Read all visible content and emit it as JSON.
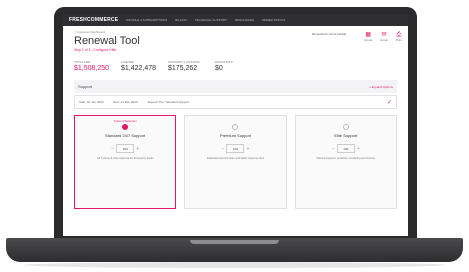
{
  "app": {
    "brand": "FRESHCOMMERCE",
    "nav": [
      "PROFILE & SUBSCRIPTIONS",
      "BILLING",
      "TECHNICAL SUPPORT",
      "RESOURCES",
      "ORDER STATUS"
    ]
  },
  "page": {
    "breadcrumb": "< Customer Dashboard",
    "title": "Renewal Tool",
    "subtitle": "Step 1 of 3 - Configure Offer",
    "account_text": "Renewal for Acme Global",
    "tools": [
      {
        "icon": "▦",
        "label": "Quote"
      },
      {
        "icon": "✉",
        "label": "Email"
      },
      {
        "icon": "⎙",
        "label": "Print"
      }
    ]
  },
  "stats": [
    {
      "label": "TOTAL ARR",
      "value": "$1,508,250",
      "accent": true
    },
    {
      "label": "LICENSE",
      "value": "$1,422,478",
      "accent": false
    },
    {
      "label": "SUPPORT & HOSTING",
      "value": "$175,262",
      "accent": false
    },
    {
      "label": "DISCOUNTS",
      "value": "$0",
      "accent": false
    }
  ],
  "section": {
    "label": "Support",
    "link": "+ Expand Options"
  },
  "filters": [
    "Start: 01 Jan 2023",
    "End: 31 Dec 2023",
    "Support Tier: Standard Support"
  ],
  "cards": [
    {
      "tag": "Current Selection",
      "name": "Standard 24/7 Support",
      "qty": "100",
      "desc": "24/7 phone & chat response for all severity levels",
      "selected": true
    },
    {
      "tag": "",
      "name": "Premium Support",
      "qty": "100",
      "desc": "Dedicated account team and faster response SLA",
      "selected": false
    },
    {
      "tag": "",
      "name": "Elite Support",
      "qty": "100",
      "desc": "Named engineer, proactive monitoring and reviews",
      "selected": false
    }
  ],
  "colors": {
    "accent": "#e4176a",
    "nav_bg": "#2f2f33",
    "laptop_body": "#2b2b2d"
  }
}
